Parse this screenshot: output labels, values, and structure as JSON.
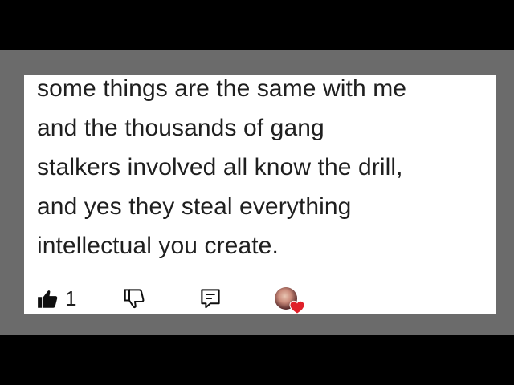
{
  "comment": {
    "lines": [
      "some things are the same with me",
      "and the thousands of gang",
      "stalkers involved all know the drill,",
      "and yes they steal everything",
      "intellectual you create."
    ]
  },
  "actions": {
    "like_count": "1",
    "like_icon": "thumbs-up-filled-icon",
    "dislike_icon": "thumbs-down-outline-icon",
    "reply_icon": "reply-comment-icon",
    "creator_heart_icon": "creator-heart-icon"
  },
  "colors": {
    "text": "#1f1f1f",
    "card_background": "#ffffff",
    "frame_background": "#6b6b6b",
    "heart": "#e0202a"
  }
}
